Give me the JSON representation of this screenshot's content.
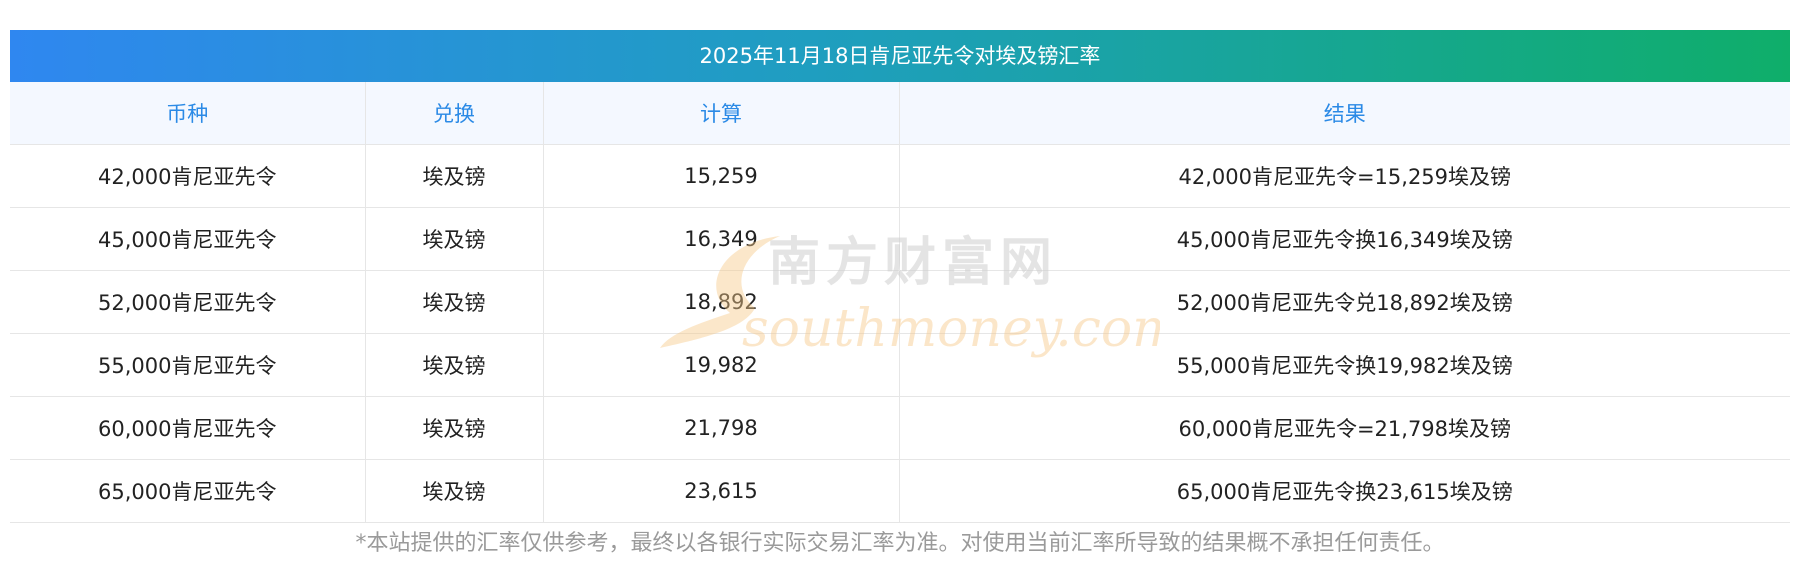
{
  "title": "2025年11月18日肯尼亚先令对埃及镑汇率",
  "headers": [
    "币种",
    "兑换",
    "计算",
    "结果"
  ],
  "rows": [
    {
      "currency": "42,000肯尼亚先令",
      "target": "埃及镑",
      "calc": "15,259",
      "result": "42,000肯尼亚先令=15,259埃及镑"
    },
    {
      "currency": "45,000肯尼亚先令",
      "target": "埃及镑",
      "calc": "16,349",
      "result": "45,000肯尼亚先令换16,349埃及镑"
    },
    {
      "currency": "52,000肯尼亚先令",
      "target": "埃及镑",
      "calc": "18,892",
      "result": "52,000肯尼亚先令兑18,892埃及镑"
    },
    {
      "currency": "55,000肯尼亚先令",
      "target": "埃及镑",
      "calc": "19,982",
      "result": "55,000肯尼亚先令换19,982埃及镑"
    },
    {
      "currency": "60,000肯尼亚先令",
      "target": "埃及镑",
      "calc": "21,798",
      "result": "60,000肯尼亚先令=21,798埃及镑"
    },
    {
      "currency": "65,000肯尼亚先令",
      "target": "埃及镑",
      "calc": "23,615",
      "result": "65,000肯尼亚先令换23,615埃及镑"
    }
  ],
  "watermark": {
    "cn": "南方财富网",
    "en": "southmoney.com"
  },
  "disclaimer": "*本站提供的汇率仅供参考，最终以各银行实际交易汇率为准。对使用当前汇率所导致的结果概不承担任何责任。",
  "colors": {
    "gradient_start": "#2f87f0",
    "gradient_end": "#0fae6a",
    "header_text": "#2b8ae6",
    "watermark": "#f7c98a"
  }
}
